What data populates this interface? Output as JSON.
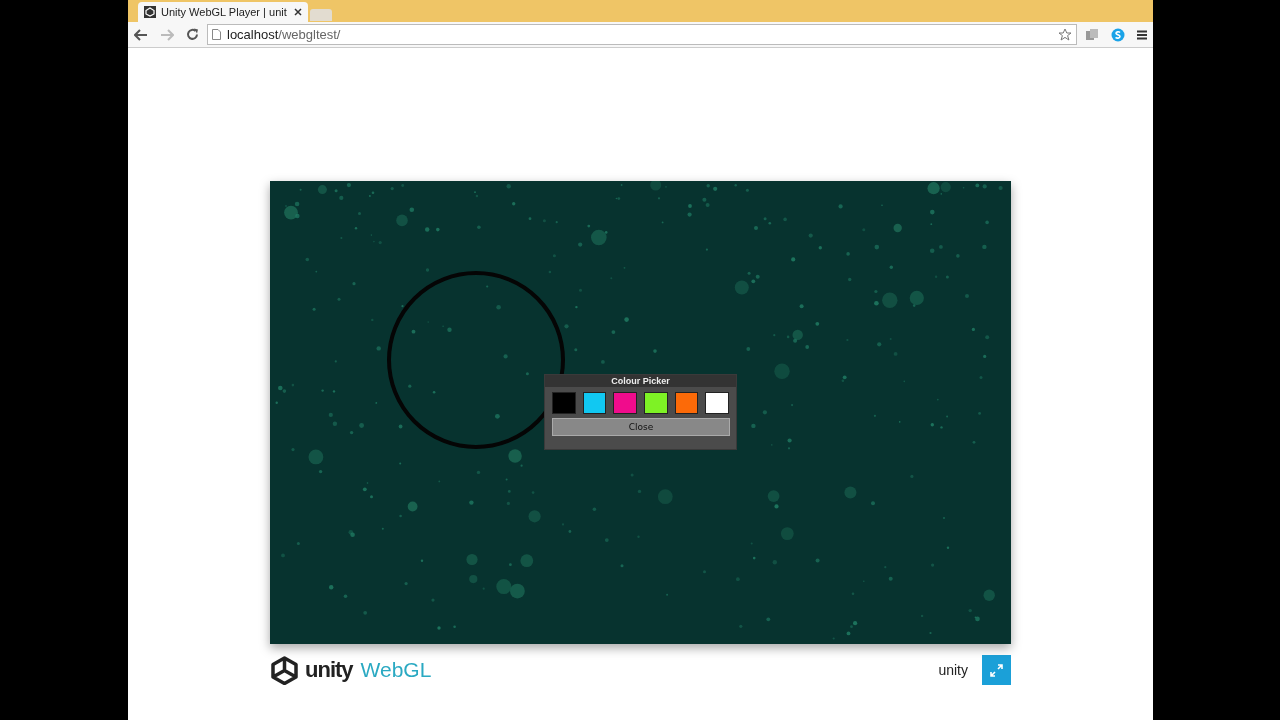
{
  "tab": {
    "title": "Unity WebGL Player | unit"
  },
  "address_bar": {
    "host": "localhost",
    "path": "/webgltest/"
  },
  "colour_picker": {
    "title": "Colour Picker",
    "swatches": [
      {
        "color": "#000000"
      },
      {
        "color": "#11c8f2"
      },
      {
        "color": "#f00c8c"
      },
      {
        "color": "#7ef225"
      },
      {
        "color": "#fc6a08"
      },
      {
        "color": "#ffffff"
      }
    ],
    "close_button": "Close"
  },
  "footer": {
    "logo_word": "unity",
    "logo_product": "WebGL",
    "brand_text": "unity"
  }
}
